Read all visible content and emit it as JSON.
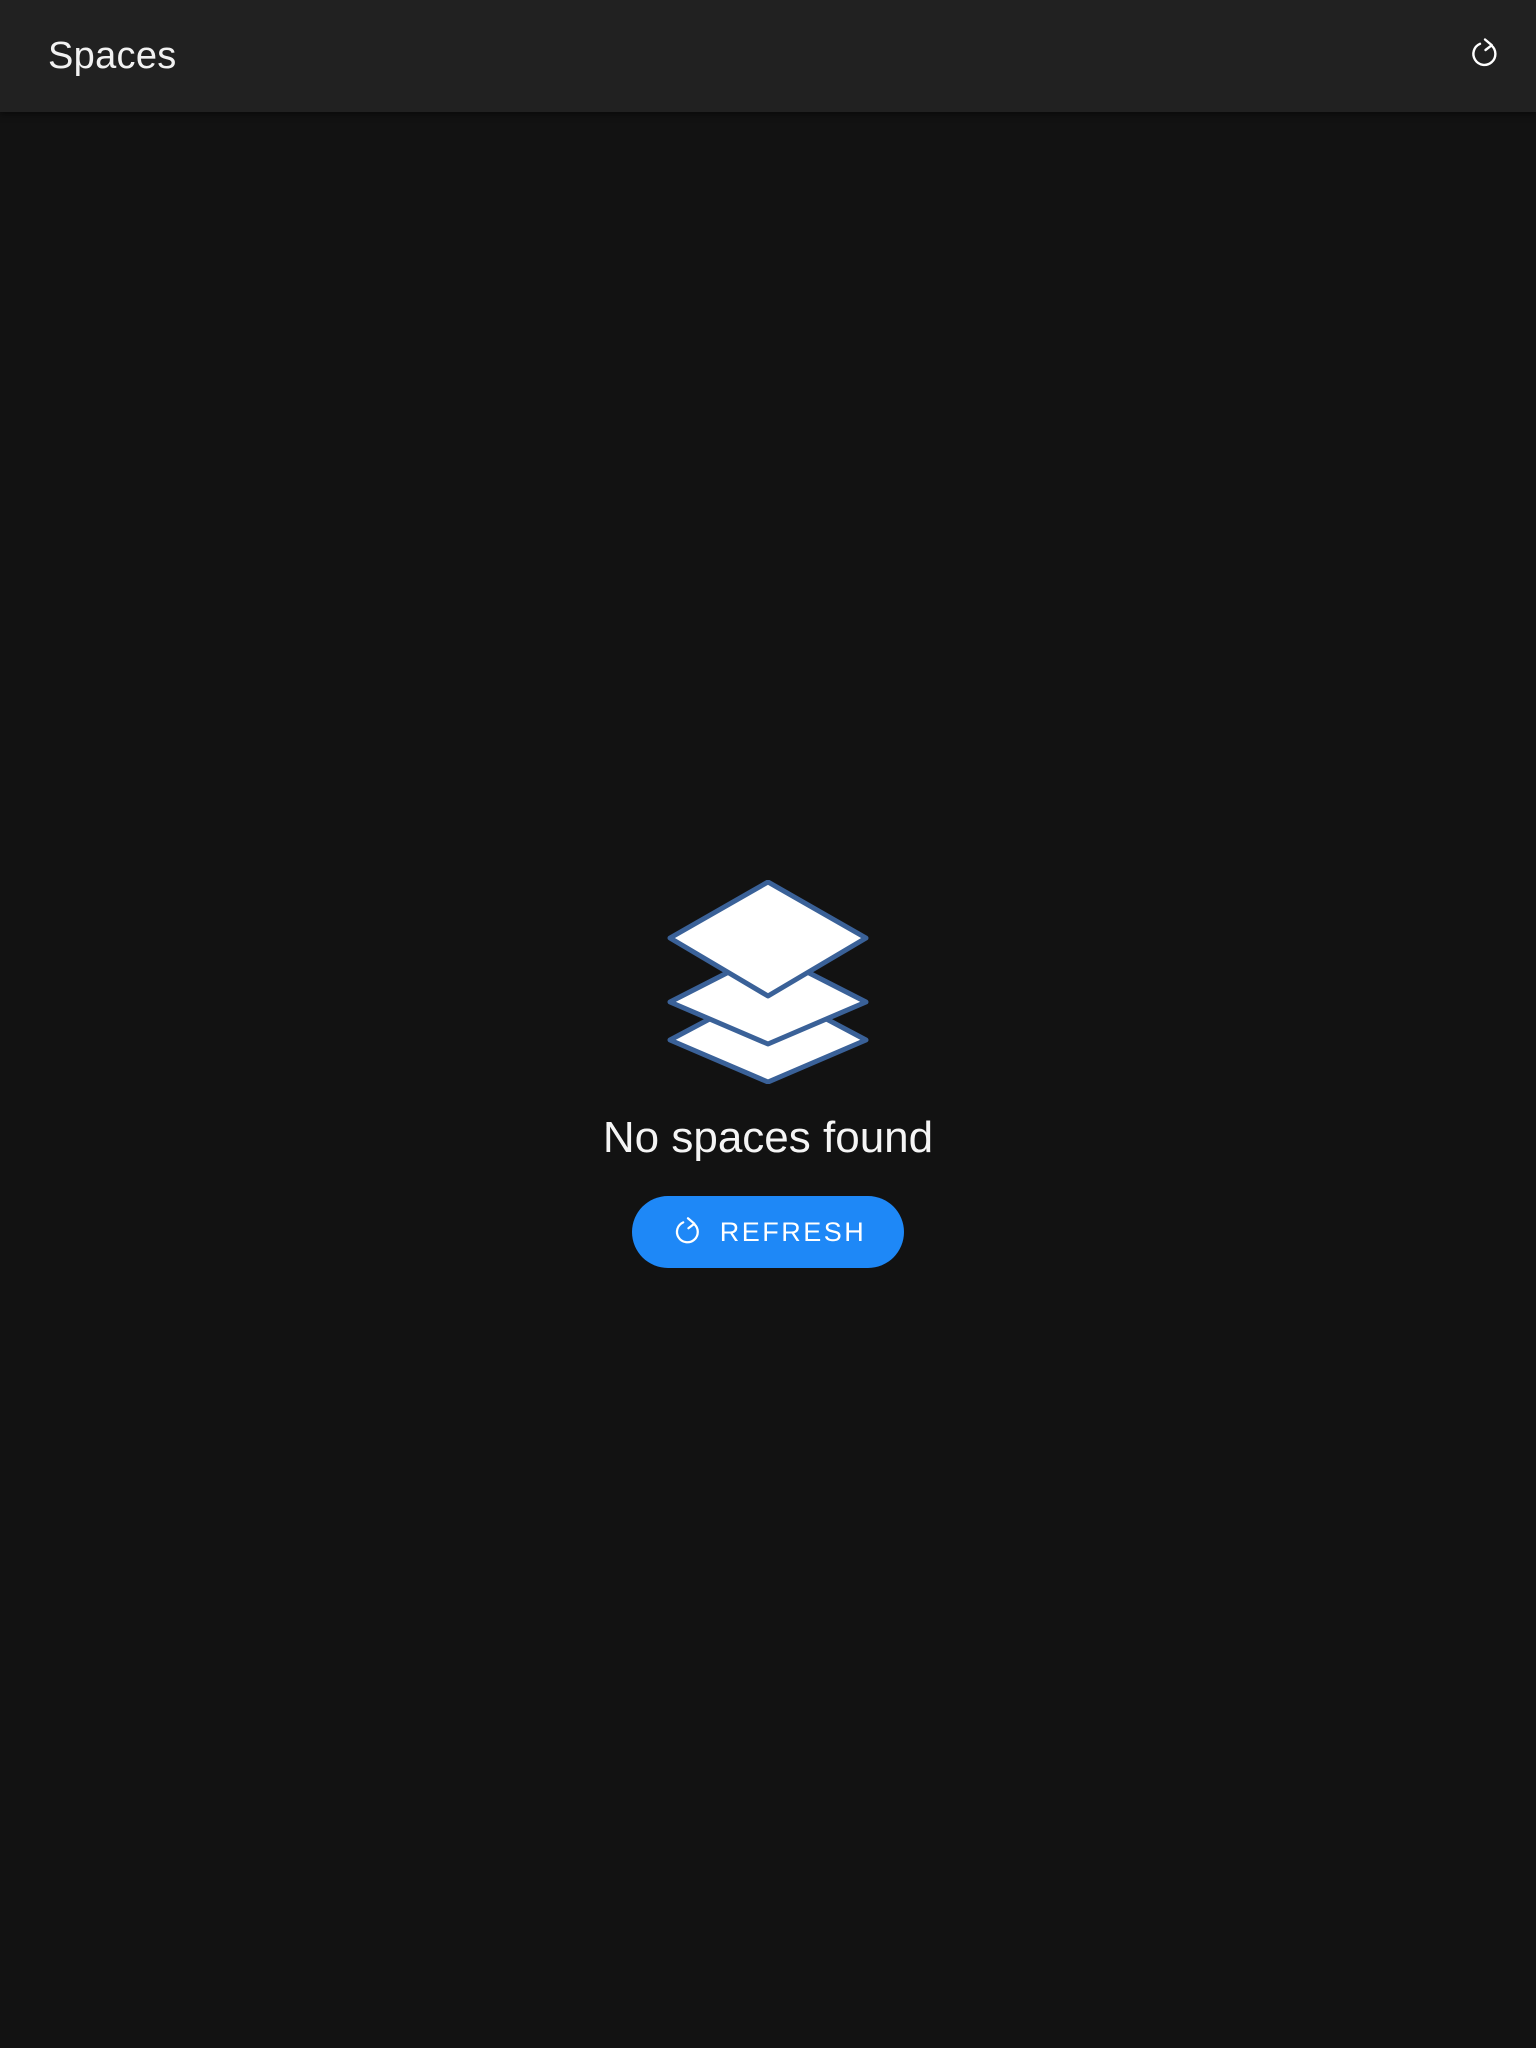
{
  "app_bar": {
    "title": "Spaces",
    "refresh_icon": "refresh-icon"
  },
  "empty_state": {
    "icon": "layers-icon",
    "message": "No spaces found",
    "button": {
      "label": "REFRESH",
      "icon": "refresh-icon"
    }
  },
  "colors": {
    "background": "#121212",
    "app_bar": "#212121",
    "accent": "#1e88f7",
    "icon_outline": "#3a6198"
  }
}
